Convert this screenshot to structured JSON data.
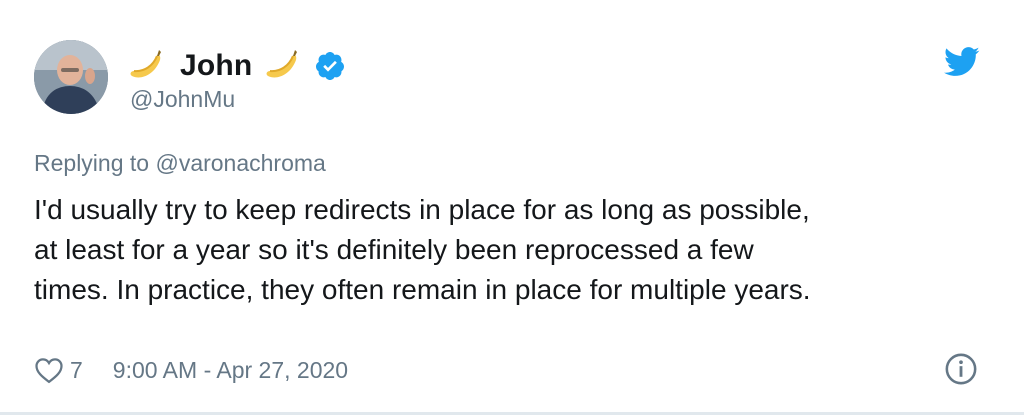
{
  "user": {
    "display_name": "John",
    "handle": "@JohnMu",
    "name_emoji": "banana-emoji",
    "verified_icon": "verified-badge-icon",
    "avatar": "user-avatar"
  },
  "brand": {
    "icon": "twitter-bird-icon",
    "accent_color": "#1da1f2"
  },
  "reply": {
    "prefix": "Replying to",
    "target": "@varonachroma"
  },
  "tweet": {
    "lines": [
      "I'd usually try to keep redirects in place for as long as possible,",
      "at least for a year so it's definitely been reprocessed a few",
      "times. In practice, they often remain in place for multiple years."
    ]
  },
  "footer": {
    "like_icon": "heart-icon",
    "like_count": "7",
    "timestamp": "9:00 AM - Apr 27, 2020",
    "info_icon": "info-icon"
  },
  "colors": {
    "text": "#14171a",
    "secondary": "#657786",
    "verified": "#1da1f2"
  }
}
